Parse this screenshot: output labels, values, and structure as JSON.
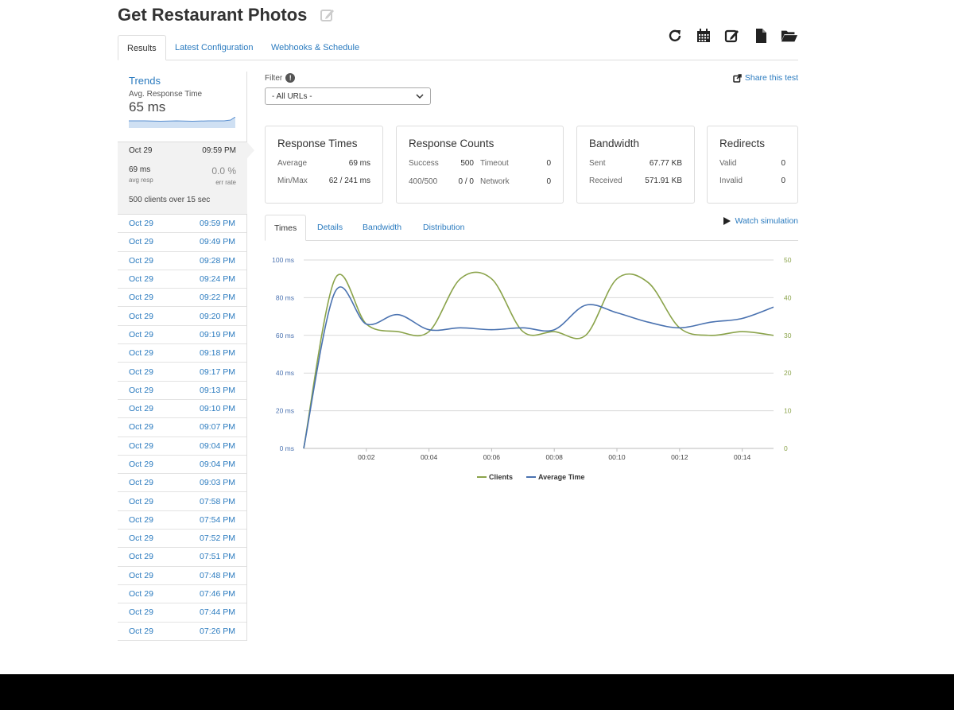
{
  "page": {
    "title": "Get Restaurant Photos"
  },
  "toolbar": {
    "icons": [
      "refresh-icon",
      "calendar-icon",
      "edit-icon",
      "file-icon",
      "folder-open-icon"
    ]
  },
  "tabs": [
    "Results",
    "Latest Configuration",
    "Webhooks & Schedule"
  ],
  "sidebar": {
    "trends_title": "Trends",
    "trends_subtitle": "Avg. Response Time",
    "trends_value": "65 ms",
    "current_run": {
      "date": "Oct 29",
      "time": "09:59 PM",
      "avg_resp_value": "69 ms",
      "avg_resp_label": "avg resp",
      "err_rate_value": "0.0 %",
      "err_rate_label": "err rate",
      "clients_count": "500",
      "clients_text_1": "clients over",
      "clients_duration": "15",
      "clients_text_2": "sec"
    },
    "runs": [
      {
        "date": "Oct 29",
        "time": "09:59 PM"
      },
      {
        "date": "Oct 29",
        "time": "09:49 PM"
      },
      {
        "date": "Oct 29",
        "time": "09:28 PM"
      },
      {
        "date": "Oct 29",
        "time": "09:24 PM"
      },
      {
        "date": "Oct 29",
        "time": "09:22 PM"
      },
      {
        "date": "Oct 29",
        "time": "09:20 PM"
      },
      {
        "date": "Oct 29",
        "time": "09:19 PM"
      },
      {
        "date": "Oct 29",
        "time": "09:18 PM"
      },
      {
        "date": "Oct 29",
        "time": "09:17 PM"
      },
      {
        "date": "Oct 29",
        "time": "09:13 PM"
      },
      {
        "date": "Oct 29",
        "time": "09:10 PM"
      },
      {
        "date": "Oct 29",
        "time": "09:07 PM"
      },
      {
        "date": "Oct 29",
        "time": "09:04 PM"
      },
      {
        "date": "Oct 29",
        "time": "09:04 PM"
      },
      {
        "date": "Oct 29",
        "time": "09:03 PM"
      },
      {
        "date": "Oct 29",
        "time": "07:58 PM"
      },
      {
        "date": "Oct 29",
        "time": "07:54 PM"
      },
      {
        "date": "Oct 29",
        "time": "07:52 PM"
      },
      {
        "date": "Oct 29",
        "time": "07:51 PM"
      },
      {
        "date": "Oct 29",
        "time": "07:48 PM"
      },
      {
        "date": "Oct 29",
        "time": "07:46 PM"
      },
      {
        "date": "Oct 29",
        "time": "07:44 PM"
      },
      {
        "date": "Oct 29",
        "time": "07:26 PM"
      }
    ]
  },
  "filter": {
    "label": "Filter",
    "info": "!",
    "selected": "- All URLs -"
  },
  "share_label": "Share this test",
  "cards": {
    "response_times": {
      "title": "Response Times",
      "avg_label": "Average",
      "avg_value": "69 ms",
      "minmax_label": "Min/Max",
      "minmax_value": "62 / 241 ms"
    },
    "response_counts": {
      "title": "Response Counts",
      "success_label": "Success",
      "success_value": "500",
      "timeout_label": "Timeout",
      "timeout_value": "0",
      "c400_label": "400/500",
      "c400_value": "0 / 0",
      "network_label": "Network",
      "network_value": "0"
    },
    "bandwidth": {
      "title": "Bandwidth",
      "sent_label": "Sent",
      "sent_value": "67.77 KB",
      "received_label": "Received",
      "received_value": "571.91 KB"
    },
    "redirects": {
      "title": "Redirects",
      "valid_label": "Valid",
      "valid_value": "0",
      "invalid_label": "Invalid",
      "invalid_value": "0"
    }
  },
  "chart_tabs": [
    "Times",
    "Details",
    "Bandwidth",
    "Distribution"
  ],
  "watch_label": "Watch simulation",
  "colors": {
    "link": "#2b7bbf",
    "clients": "#8aa34a",
    "average_time": "#4a72b0"
  },
  "chart_data": {
    "type": "line",
    "x": [
      "00:00",
      "00:01",
      "00:02",
      "00:03",
      "00:04",
      "00:05",
      "00:06",
      "00:07",
      "00:08",
      "00:09",
      "00:10",
      "00:11",
      "00:12",
      "00:13",
      "00:14",
      "00:15"
    ],
    "x_tick_labels": [
      "00:02",
      "00:04",
      "00:06",
      "00:08",
      "00:10",
      "00:12",
      "00:14"
    ],
    "y_left_ticks": [
      "0 ms",
      "20 ms",
      "40 ms",
      "60 ms",
      "80 ms",
      "100 ms"
    ],
    "y_left_lim": [
      0,
      100
    ],
    "y_right_ticks": [
      "0",
      "10",
      "20",
      "30",
      "40",
      "50"
    ],
    "y_right_lim": [
      0,
      50
    ],
    "grid": true,
    "legend_position": "bottom-center",
    "series": [
      {
        "name": "Clients",
        "axis": "right",
        "values": [
          0,
          45,
          33,
          31,
          31,
          45,
          45,
          31,
          31,
          30,
          45,
          44,
          32,
          30,
          31,
          30
        ]
      },
      {
        "name": "Average Time",
        "axis": "left",
        "values": [
          0,
          83,
          66,
          71,
          63,
          64,
          63,
          64,
          63,
          76,
          72,
          67,
          64,
          67,
          69,
          75
        ]
      }
    ]
  }
}
